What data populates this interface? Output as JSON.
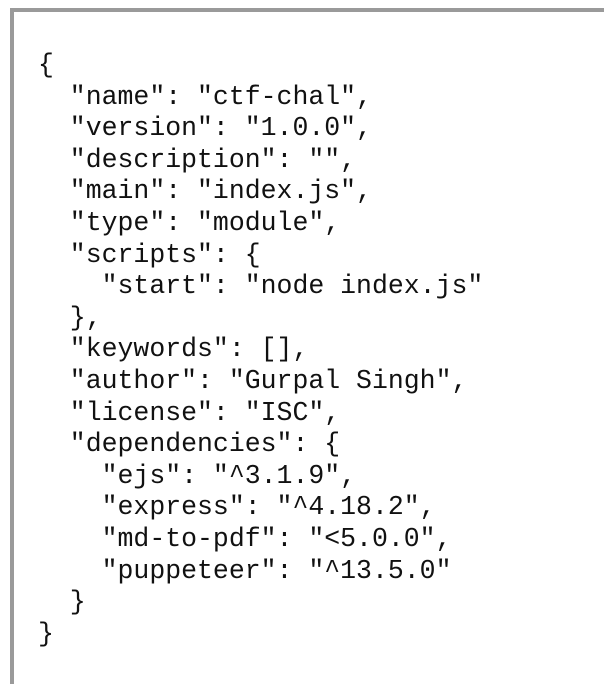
{
  "code": {
    "lines": [
      "{",
      "  \"name\": \"ctf-chal\",",
      "  \"version\": \"1.0.0\",",
      "  \"description\": \"\",",
      "  \"main\": \"index.js\",",
      "  \"type\": \"module\",",
      "  \"scripts\": {",
      "    \"start\": \"node index.js\"",
      "  },",
      "  \"keywords\": [],",
      "  \"author\": \"Gurpal Singh\",",
      "  \"license\": \"ISC\",",
      "  \"dependencies\": {",
      "    \"ejs\": \"^3.1.9\",",
      "    \"express\": \"^4.18.2\",",
      "    \"md-to-pdf\": \"<5.0.0\",",
      "    \"puppeteer\": \"^13.5.0\"",
      "  }",
      "}"
    ]
  },
  "colors": {
    "border": "#9a9a9a",
    "text": "#111111",
    "background": "#ffffff"
  }
}
